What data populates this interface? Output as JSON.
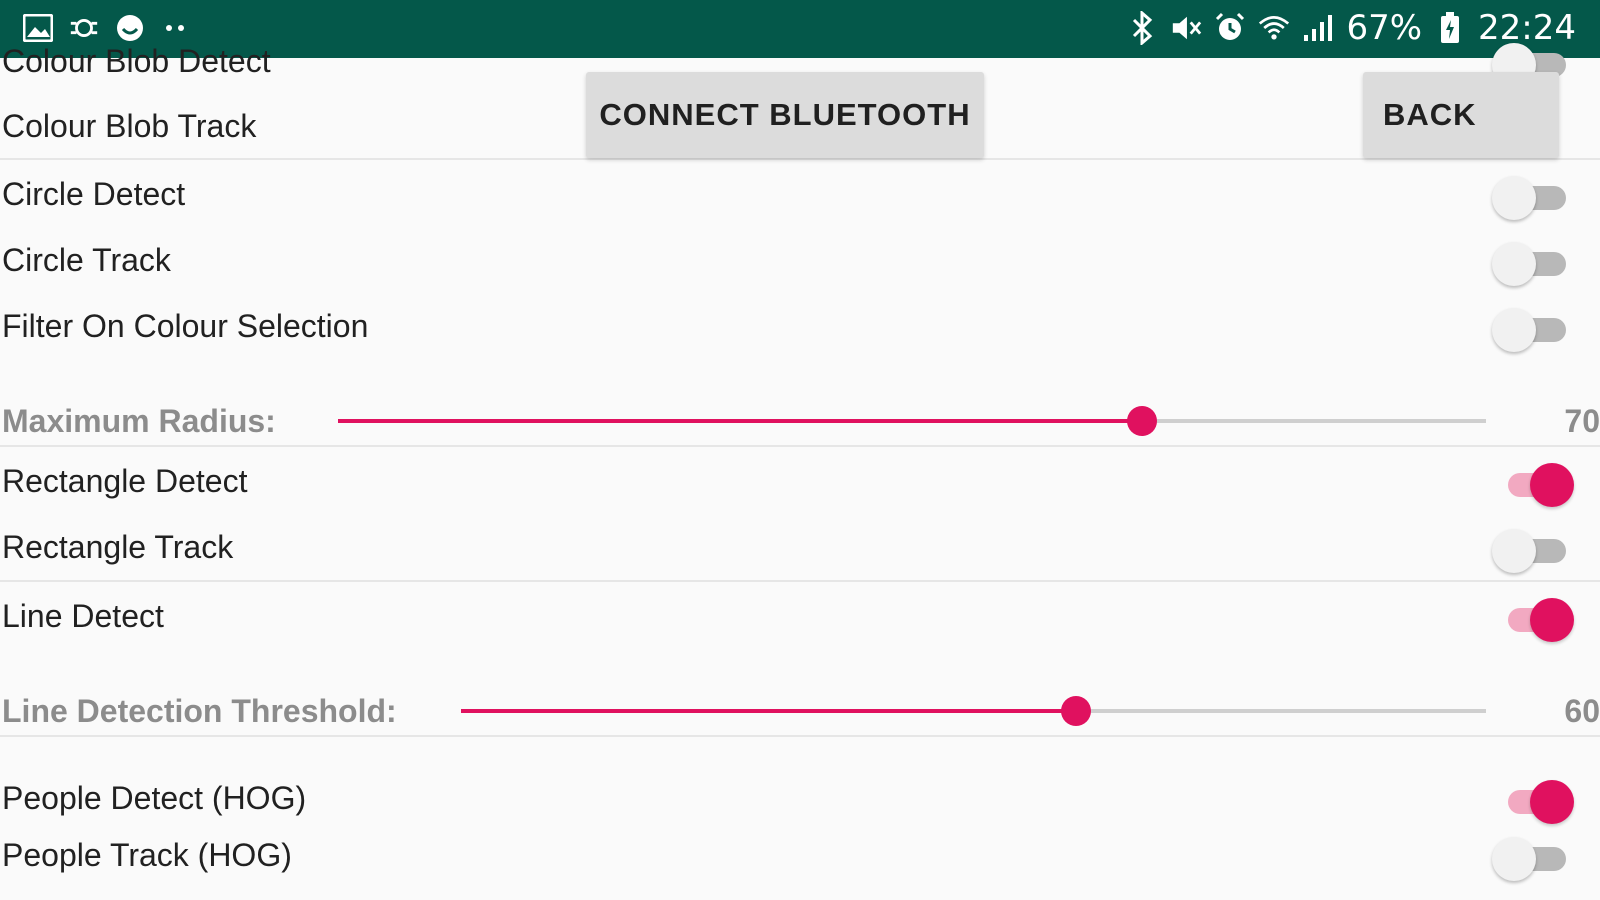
{
  "status_bar": {
    "left_icons": [
      "image-icon",
      "sync-icon",
      "smiley-icon",
      "more-dots-icon"
    ],
    "right_icons": [
      "bluetooth-icon",
      "mute-icon",
      "alarm-icon",
      "wifi-icon",
      "signal-icon"
    ],
    "battery_percent": "67%",
    "time": "22:24",
    "bg_color": "#04584a"
  },
  "buttons": {
    "connect_bluetooth": "CONNECT BLUETOOTH",
    "back": "BACK"
  },
  "settings": {
    "partial_top": "Colour Blob Detect",
    "colour_blob_track": "Colour Blob Track",
    "circle_detect": "Circle Detect",
    "circle_track": "Circle Track",
    "filter_on_colour": "Filter On Colour Selection",
    "max_radius_label": "Maximum Radius:",
    "max_radius_value": "70",
    "max_radius_fraction": 0.7,
    "rectangle_detect": "Rectangle Detect",
    "rectangle_track": "Rectangle Track",
    "line_detect": "Line Detect",
    "line_threshold_label": "Line Detection Threshold:",
    "line_threshold_value": "60",
    "line_threshold_fraction": 0.6,
    "people_detect": "People Detect (HOG)",
    "people_track": "People Track (HOG)"
  },
  "switch_states": {
    "colour_blob_detect": false,
    "colour_blob_track": false,
    "circle_detect": false,
    "circle_track": false,
    "filter_on_colour": false,
    "rectangle_detect": true,
    "rectangle_track": false,
    "line_detect": true,
    "people_detect": true,
    "people_track": false
  },
  "accent_color": "#e0115f"
}
